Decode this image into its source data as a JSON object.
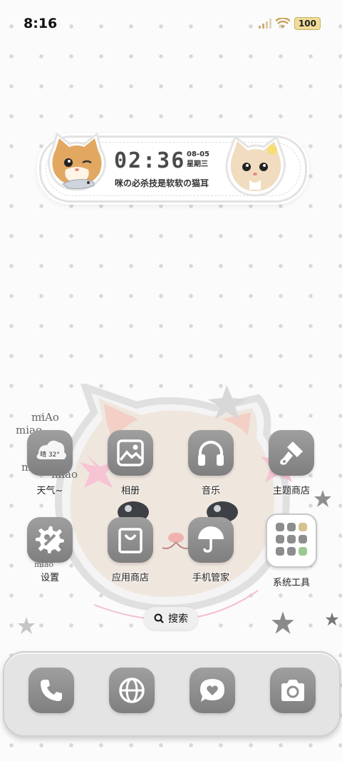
{
  "status": {
    "time": "8:16",
    "battery": "100",
    "signal_icon": "signal-icon",
    "wifi_icon": "wifi-icon"
  },
  "widget": {
    "time": "02:36",
    "date": "08-05",
    "weekday": "星期三",
    "subtitle": "咪の必杀技是软软の猫耳"
  },
  "decor": {
    "miao1": "miAo",
    "miao2": "miao",
    "miao3": "mia",
    "miao4": "miao",
    "miao5": "miao"
  },
  "apps": [
    {
      "label": "天气~",
      "icon": "weather-icon",
      "weather_text": "晴 32°"
    },
    {
      "label": "相册",
      "icon": "gallery-icon"
    },
    {
      "label": "音乐",
      "icon": "headphones-icon"
    },
    {
      "label": "主题商店",
      "icon": "brush-icon"
    },
    {
      "label": "设置",
      "icon": "gear-icon"
    },
    {
      "label": "应用商店",
      "icon": "shopping-bag-icon"
    },
    {
      "label": "手机管家",
      "icon": "umbrella-icon"
    },
    {
      "label": "系统工具",
      "icon": "folder-icon"
    }
  ],
  "search": {
    "label": "搜索"
  },
  "dock": [
    {
      "icon": "phone-icon"
    },
    {
      "icon": "browser-icon"
    },
    {
      "icon": "message-icon"
    },
    {
      "icon": "camera-icon"
    }
  ]
}
